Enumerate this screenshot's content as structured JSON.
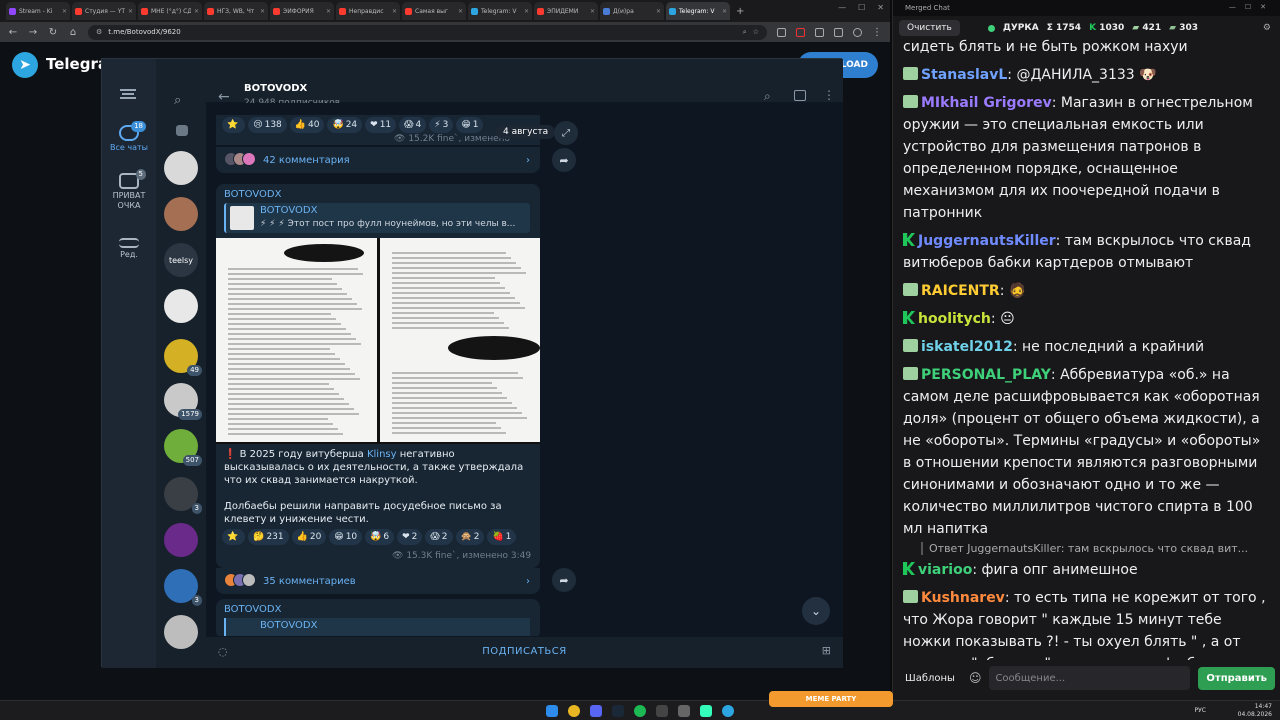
{
  "browser": {
    "tabs": [
      {
        "label": "Stream - Ki",
        "color": "#9147ff"
      },
      {
        "label": "Студия — YT",
        "color": "#ff3b30"
      },
      {
        "label": "МНЕ (°д°) СД",
        "color": "#ff3b30"
      },
      {
        "label": "НГЗ, WB, Чт",
        "color": "#ff3b30"
      },
      {
        "label": "ЭЙФОРИЯ",
        "color": "#ff3b30"
      },
      {
        "label": "Неправдис",
        "color": "#ff3b30"
      },
      {
        "label": "Самая выг",
        "color": "#ff3b30"
      },
      {
        "label": "Telegram: V",
        "color": "#2ca5e0"
      },
      {
        "label": "ЭПИДЕМИ",
        "color": "#ff3b30"
      },
      {
        "label": "Д(и)ра",
        "color": "#4a7bd6"
      },
      {
        "label": "Telegram: V",
        "color": "#2ca5e0"
      }
    ],
    "url": "t.me/BotovodX/9620"
  },
  "tgweb": {
    "brand": "Telegram",
    "download_label": "LOAD"
  },
  "telegram": {
    "channel_title": "BOTOVODX",
    "subscribers": "24 948 подписчиков",
    "rail": {
      "all_chats": "Все чаты",
      "all_badge": "18",
      "private": "ПРИВАТ ОЧКА",
      "private_badge": "5",
      "edit": "Ред."
    },
    "chat_badges": [
      "49",
      "1579",
      "507",
      "3",
      "3"
    ],
    "post1": {
      "reactions": [
        {
          "emoji": "⭐",
          "count": ""
        },
        {
          "emoji": "😢",
          "count": "138"
        },
        {
          "emoji": "👍",
          "count": "40"
        },
        {
          "emoji": "🤯",
          "count": "24"
        },
        {
          "emoji": "❤",
          "count": "11"
        },
        {
          "emoji": "😱",
          "count": "4"
        },
        {
          "emoji": "⚡",
          "count": "3"
        },
        {
          "emoji": "😁",
          "count": "1"
        }
      ],
      "views": "15.2K",
      "meta": "fine`, изменено",
      "comments": "42 комментария"
    },
    "date_chip": "4 августа",
    "post2": {
      "author": "BOTOVODX",
      "quote_author": "BOTOVODX",
      "quote_text": "⚡ ⚡ ⚡ Этот пост про фулл ноунеймов, но эти челы в...",
      "text_a_prefix": "❗ В 2025 году витуберша ",
      "text_a_link": "Klinsy",
      "text_a_suffix": " негативно высказывалась о их деятельности, а также утверждала что их сквад занимается накруткой.",
      "text_b": "Долбаебы решили направить досудебное письмо за клевету и унижение чести.",
      "reactions": [
        {
          "emoji": "⭐",
          "count": ""
        },
        {
          "emoji": "🤔",
          "count": "231"
        },
        {
          "emoji": "👍",
          "count": "20"
        },
        {
          "emoji": "😁",
          "count": "10"
        },
        {
          "emoji": "🤯",
          "count": "6"
        },
        {
          "emoji": "❤",
          "count": "2"
        },
        {
          "emoji": "😱",
          "count": "2"
        },
        {
          "emoji": "🙊",
          "count": "2"
        },
        {
          "emoji": "🍓",
          "count": "1"
        }
      ],
      "views": "15.3K",
      "meta": "fine`, изменено 3:49",
      "comments": "35 комментариев"
    },
    "post3": {
      "author": "BOTOVODX",
      "quote_author": "BOTOVODX"
    },
    "subscribe": "ПОДПИСАТЬСЯ"
  },
  "merged_chat": {
    "window_title": "Merged Chat",
    "clear": "Очистить",
    "status": "ДУРКА",
    "stats": [
      {
        "icon": "Σ",
        "value": "1754",
        "color": "#eee"
      },
      {
        "icon": "K",
        "value": "1030",
        "color": "#1fc65a"
      },
      {
        "icon": "▰",
        "value": "421",
        "color": "#9fd0a0"
      },
      {
        "icon": "▰",
        "value": "303",
        "color": "#8fbf90"
      }
    ],
    "messages": [
      {
        "type": "plain",
        "nick": "",
        "nick_color": "",
        "text": "сидеть блять и не быть рожком нахуи"
      },
      {
        "type": "t",
        "nick": "StanaslavL",
        "nick_color": "#6fa3ff",
        "text": "@ДАНИЛА_3133 🐶"
      },
      {
        "type": "t",
        "nick": "MIkhail Grigorev",
        "nick_color": "#9b7bff",
        "text": "Магазин в огнестрельном оружии — это специальная емкость или устройство для размещения патронов в определенном порядке, оснащенное механизмом для их поочередной подачи в патронник"
      },
      {
        "type": "k",
        "nick": "JuggernautsKiller",
        "nick_color": "#6f8bff",
        "text": "там вскрылось что сквад витюберов бабки картдеров отмывают"
      },
      {
        "type": "t",
        "nick": "RAICENTR",
        "nick_color": "#ffcc33",
        "text": "🧔"
      },
      {
        "type": "k",
        "nick": "hoolitych",
        "nick_color": "#c8e33a",
        "text": "😐"
      },
      {
        "type": "t",
        "nick": "iskatel2012",
        "nick_color": "#6fd0e8",
        "text": "не последний а крайний"
      },
      {
        "type": "t",
        "nick": "PERSONAL_PLAY",
        "nick_color": "#3fd07a",
        "text": "Аббревиатура «об.» на самом деле расшифровывается как «оборотная доля» (процент от общего объема жидкости), а не «обороты». Термины «градусы» и «обороты» в отношении крепости являются разговорными синонимами и обозначают одно и то же — количество миллилитров чистого спирта в 100 мл напитка"
      },
      {
        "type": "reply",
        "nick": "JuggernautsKiller",
        "nick_color": "#9b7bff",
        "text": "Ответ JuggernautsKiller: там вскрылось что сквад вит..."
      },
      {
        "type": "k",
        "nick": "viarioo",
        "nick_color": "#3fd07a",
        "text": "фига опг анимешное"
      },
      {
        "type": "t",
        "nick": "Kushnarev",
        "nick_color": "#ff8a3d",
        "text": "то есть типа не корежит от того , что Жора говорит \" каждые 15 минут тебе ножки показывать ?! - ты охуел блять \" , а от жаргона \"обороты \" его корежит . фу бля . чепуха ебанная"
      }
    ],
    "templates": "Шаблоны",
    "input_placeholder": "Сообщение...",
    "send": "Отправить"
  },
  "taskbar": {
    "lang": "РУС",
    "time": "14:47",
    "date": "04.08.2026",
    "meme": "MEME PARTY"
  }
}
